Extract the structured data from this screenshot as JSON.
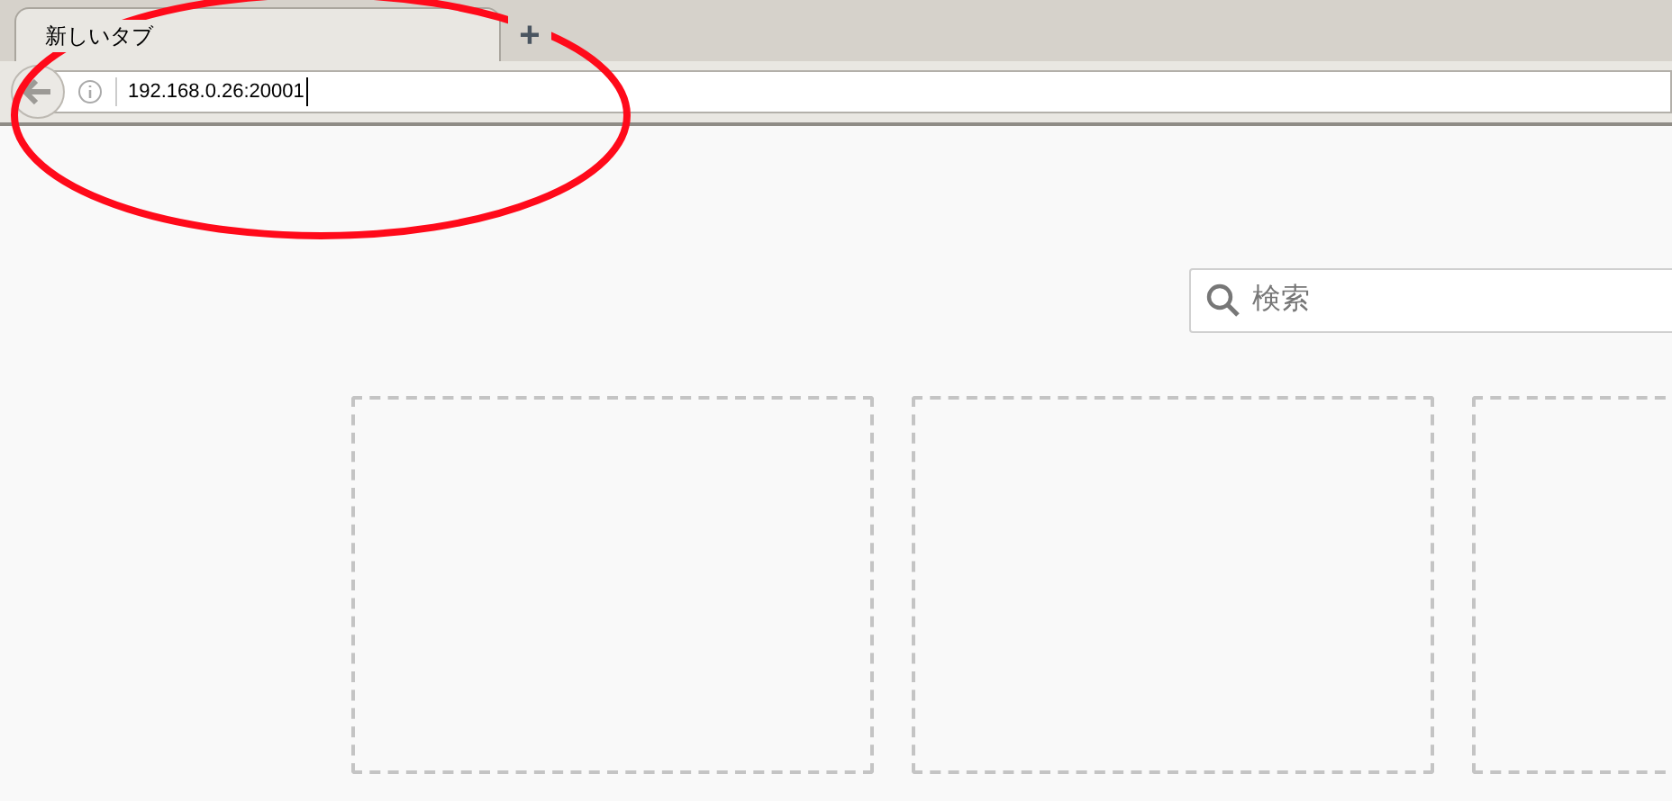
{
  "tabs": [
    {
      "label": "新しいタブ",
      "selected": true
    }
  ],
  "new_tab_button": "+",
  "address_bar": {
    "value": "192.168.0.26:20001"
  },
  "search": {
    "placeholder": "検索"
  },
  "tiles": [
    {
      "kind": "empty"
    },
    {
      "kind": "empty"
    },
    {
      "kind": "empty"
    }
  ],
  "annotation": {
    "kind": "ellipse"
  }
}
